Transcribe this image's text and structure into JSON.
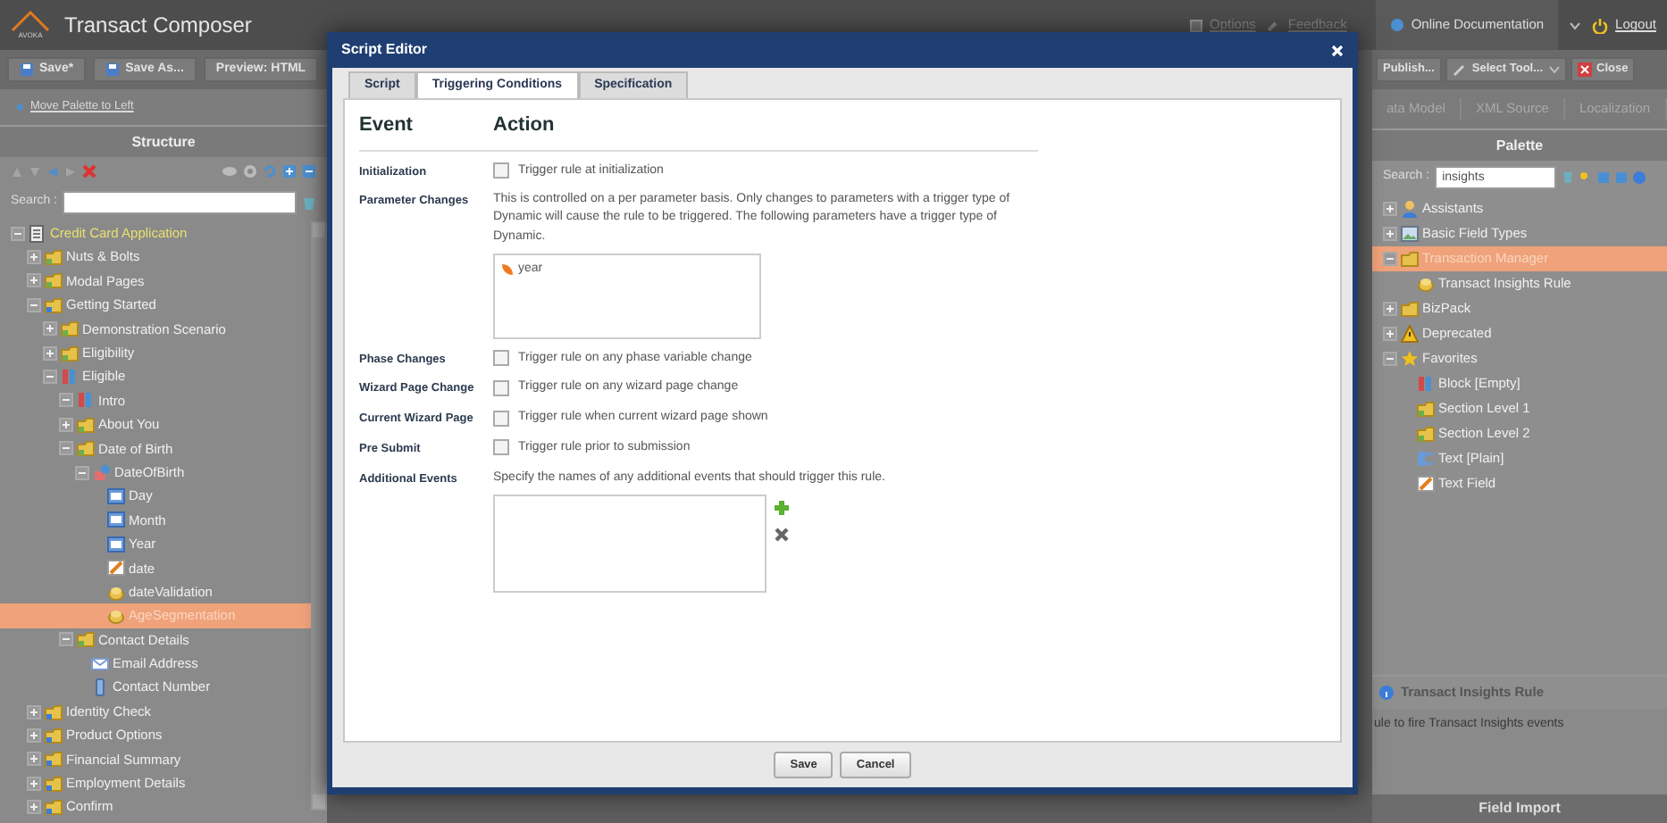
{
  "app": {
    "title": "Transact Composer",
    "logo_text": "AVOKA",
    "top_links": [
      "Options",
      "Feedback"
    ],
    "documentation": "Online Documentation",
    "logout": "Logout"
  },
  "toolbar_left": [
    {
      "label": "Save*",
      "kind": "save"
    },
    {
      "label": "Save As...",
      "kind": "save"
    },
    {
      "label": "Preview: HTML",
      "kind": "plain"
    }
  ],
  "move_palette": "Move Palette to Left",
  "structure": {
    "title": "Structure",
    "search_label": "Search :",
    "tree": [
      {
        "label": "Credit Card Application",
        "kind": "form",
        "expanded": true,
        "selected": false,
        "children": [
          {
            "label": "Nuts & Bolts",
            "kind": "section",
            "expanded": false,
            "selected": false
          },
          {
            "label": "Modal Pages",
            "kind": "section",
            "expanded": false,
            "selected": false
          },
          {
            "label": "Getting Started",
            "kind": "page",
            "expanded": true,
            "selected": false,
            "children": [
              {
                "label": "Demonstration Scenario",
                "kind": "section",
                "expanded": false,
                "selected": false
              },
              {
                "label": "Eligibility",
                "kind": "section",
                "expanded": false,
                "selected": false
              },
              {
                "label": "Eligible",
                "kind": "block",
                "expanded": true,
                "selected": false,
                "children": [
                  {
                    "label": "Intro",
                    "kind": "block",
                    "expanded": true,
                    "selected": false
                  },
                  {
                    "label": "About You",
                    "kind": "section",
                    "expanded": false,
                    "selected": false
                  },
                  {
                    "label": "Date of Birth",
                    "kind": "section",
                    "expanded": true,
                    "selected": false,
                    "children": [
                      {
                        "label": "DateOfBirth",
                        "kind": "group",
                        "expanded": true,
                        "selected": false,
                        "children": [
                          {
                            "label": "Day",
                            "kind": "textfield",
                            "selected": false
                          },
                          {
                            "label": "Month",
                            "kind": "textfield",
                            "selected": false
                          },
                          {
                            "label": "Year",
                            "kind": "textfield",
                            "selected": false
                          },
                          {
                            "label": "date",
                            "kind": "edit",
                            "selected": false
                          },
                          {
                            "label": "dateValidation",
                            "kind": "rule",
                            "selected": false
                          },
                          {
                            "label": "AgeSegmentation",
                            "kind": "rule",
                            "selected": true
                          }
                        ]
                      }
                    ]
                  },
                  {
                    "label": "Contact Details",
                    "kind": "section",
                    "expanded": true,
                    "selected": false,
                    "children": [
                      {
                        "label": "Email Address",
                        "kind": "email",
                        "selected": false
                      },
                      {
                        "label": "Contact Number",
                        "kind": "phone",
                        "selected": false
                      }
                    ]
                  }
                ]
              }
            ]
          },
          {
            "label": "Identity Check",
            "kind": "page",
            "expanded": false,
            "selected": false
          },
          {
            "label": "Product Options",
            "kind": "page",
            "expanded": false,
            "selected": false
          },
          {
            "label": "Financial Summary",
            "kind": "page",
            "expanded": false,
            "selected": false
          },
          {
            "label": "Employment Details",
            "kind": "page",
            "expanded": false,
            "selected": false
          },
          {
            "label": "Confirm",
            "kind": "page",
            "expanded": false,
            "selected": false
          }
        ]
      }
    ]
  },
  "toolbar_right": [
    {
      "label": "Publish...",
      "kind": "plain"
    },
    {
      "label": "Select Tool...",
      "kind": "dropdown"
    },
    {
      "label": "Close",
      "kind": "close"
    }
  ],
  "right_tabs": [
    "ata Model",
    "XML Source",
    "Localization"
  ],
  "palette": {
    "title": "Palette",
    "search_label": "Search :",
    "search_value": "insights",
    "tree": [
      {
        "label": "Assistants",
        "kind": "person",
        "expanded": false,
        "selected": false
      },
      {
        "label": "Basic Field Types",
        "kind": "image",
        "expanded": false,
        "selected": false
      },
      {
        "label": "Transaction Manager",
        "kind": "folder",
        "expanded": true,
        "selected": true,
        "children": [
          {
            "label": "Transact Insights Rule",
            "kind": "rule",
            "selected": false
          }
        ]
      },
      {
        "label": "BizPack",
        "kind": "folder",
        "expanded": false,
        "selected": false
      },
      {
        "label": "Deprecated",
        "kind": "warning",
        "expanded": false,
        "selected": false
      },
      {
        "label": "Favorites",
        "kind": "star",
        "expanded": true,
        "selected": false,
        "children": [
          {
            "label": "Block [Empty]",
            "kind": "block",
            "selected": false
          },
          {
            "label": "Section Level 1",
            "kind": "section",
            "selected": false
          },
          {
            "label": "Section Level 2",
            "kind": "section",
            "selected": false
          },
          {
            "label": "Text [Plain]",
            "kind": "text",
            "selected": false
          },
          {
            "label": "Text Field",
            "kind": "edit",
            "selected": false
          }
        ]
      }
    ],
    "info_title": "Transact Insights Rule",
    "info_text": "ule to fire Transact Insights events",
    "footer": "Field Import"
  },
  "dialog": {
    "title": "Script Editor",
    "tabs": [
      {
        "label": "Script",
        "selected": false
      },
      {
        "label": "Triggering Conditions",
        "selected": true
      },
      {
        "label": "Specification",
        "selected": false
      }
    ],
    "columns": [
      "Event",
      "Action"
    ],
    "events": [
      {
        "event": "Initialization",
        "kind": "checkbox",
        "label": "Trigger rule at initialization",
        "checked": false
      },
      {
        "event": "Parameter Changes",
        "kind": "parameters",
        "description": "This is controlled on a per parameter basis. Only changes to parameters with a trigger type of Dynamic will cause the rule to be triggered. The following parameters have a trigger type of Dynamic.",
        "parameters": [
          "year"
        ]
      },
      {
        "event": "Phase Changes",
        "kind": "checkbox",
        "label": "Trigger rule on any phase variable change",
        "checked": false
      },
      {
        "event": "Wizard Page Change",
        "kind": "checkbox",
        "label": "Trigger rule on any wizard page change",
        "checked": false
      },
      {
        "event": "Current Wizard Page",
        "kind": "checkbox",
        "label": "Trigger rule when current wizard page shown",
        "checked": false
      },
      {
        "event": "Pre Submit",
        "kind": "checkbox",
        "label": "Trigger rule prior to submission",
        "checked": false
      },
      {
        "event": "Additional Events",
        "kind": "events",
        "description": "Specify the names of any additional events that should trigger this rule."
      }
    ],
    "buttons": [
      "Save",
      "Cancel"
    ]
  }
}
